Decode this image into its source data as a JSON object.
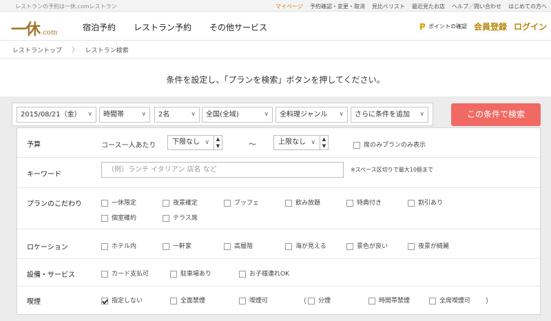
{
  "topbar": {
    "tagline": "レストランの予約は一休.comレストラン",
    "links": [
      "マイページ",
      "予約確認・変更・取消",
      "見比べリスト",
      "最近見たお店",
      "ヘルプ／問い合わせ",
      "はじめての方へ"
    ]
  },
  "header": {
    "logo_mark": "一休",
    "logo_domain": ".com",
    "nav": [
      "宿泊予約",
      "レストラン予約",
      "その他サービス"
    ],
    "points_badge": "P",
    "points_label": "ポイントの確認",
    "register": "会員登録",
    "login": "ログイン"
  },
  "breadcrumb": [
    "レストラントップ",
    "レストラン検索"
  ],
  "instruction": "条件を設定し、「プランを検索」ボタンを押してください。",
  "searchbar": {
    "date": "2015/08/21（金）",
    "time": "時間帯",
    "people": "2名",
    "area": "全国(全域)",
    "genre": "全料理ジャンル",
    "more": "さらに条件を追加",
    "button": "この条件で検索"
  },
  "panel": {
    "budget": {
      "label": "予算",
      "per_person": "コース一人あたり",
      "min": "下限なし",
      "tilde": "〜",
      "max": "上限なし",
      "seat_only": "席のみプランのみ表示"
    },
    "keyword": {
      "label": "キーワード",
      "placeholder": "（例）ランチ イタリアン 店名 など",
      "note": "※スペース区切りで最大10個まで"
    },
    "plan": {
      "label": "プランのこだわり",
      "options": [
        "一休限定",
        "夜景確定",
        "ブッフェ",
        "飲み放題",
        "特典付き",
        "割引あり",
        "個室確約",
        "テラス席"
      ]
    },
    "location": {
      "label": "ロケーション",
      "options": [
        "ホテル内",
        "一軒家",
        "高層階",
        "海が見える",
        "景色が良い",
        "夜景が綺麗"
      ]
    },
    "facility": {
      "label": "設備・サービス",
      "options": [
        "カード支払可",
        "駐車場あり",
        "お子様連れOK"
      ]
    },
    "smoking": {
      "label": "喫煙",
      "options": [
        "指定しない",
        "全面禁煙",
        "喫煙可",
        "分煙",
        "時間帯禁煙",
        "全席喫煙可"
      ],
      "paren_open": "（",
      "paren_close": "）"
    }
  }
}
